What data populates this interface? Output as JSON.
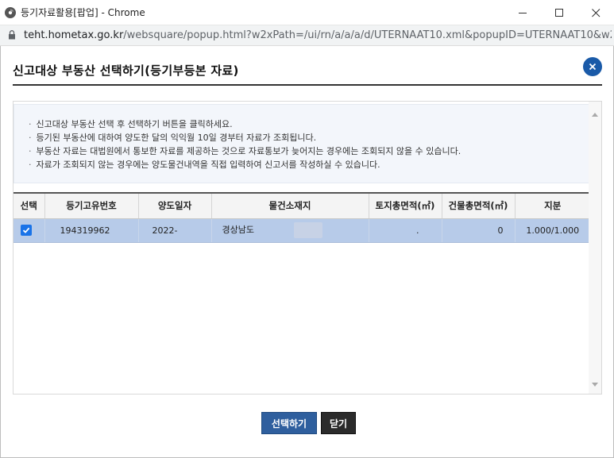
{
  "window": {
    "title": "등기자료활용[팝업] - Chrome",
    "url_host": "teht.hometax.go.kr",
    "url_path": "/websquare/popup.html?w2xPath=/ui/rn/a/a/a/d/UTERNAAT10.xml&popupID=UTERNAAT10&w2x..."
  },
  "popup": {
    "title": "신고대상 부동산 선택하기(등기부등본 자료)"
  },
  "notice": {
    "lines": [
      "신고대상 부동산 선택 후 선택하기 버튼을 클릭하세요.",
      "등기된 부동산에 대하여 양도한 달의 익익월 10일 경부터 자료가 조회됩니다.",
      "부동산 자료는 대법원에서 통보한 자료를 제공하는 것으로 자료통보가 늦어지는 경우에는 조회되지 않을 수 있습니다.",
      "자료가 조회되지 않는 경우에는 양도물건내역을 직접 입력하여 신고서를 작성하실 수 있습니다."
    ]
  },
  "table": {
    "headers": [
      "선택",
      "등기고유번호",
      "양도일자",
      "물건소재지",
      "토지총면적(㎡)",
      "건물총면적(㎡)",
      "지분"
    ],
    "rows": [
      {
        "checked": true,
        "reg_no": "194319962",
        "date": "2022-",
        "address": "경상남도",
        "land_area": ".",
        "building_area": "0",
        "share": "1.000/1.000"
      }
    ]
  },
  "buttons": {
    "select": "선택하기",
    "close": "닫기"
  }
}
